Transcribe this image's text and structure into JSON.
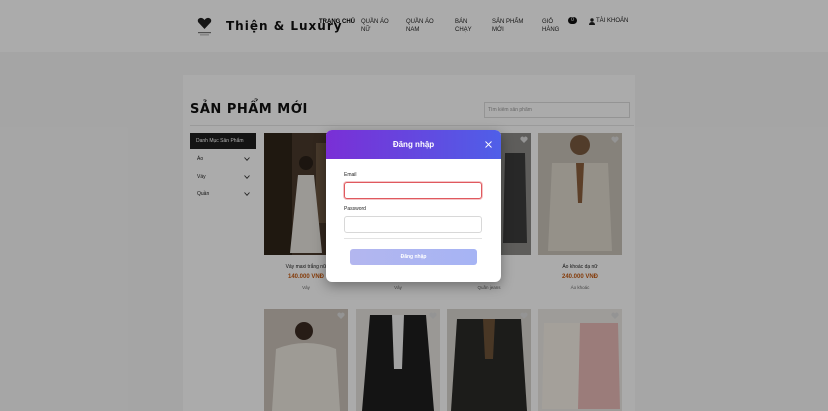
{
  "header": {
    "brand": "Thiện & Luxury",
    "nav": [
      {
        "label": "TRANG CHỦ",
        "active": true
      },
      {
        "label": "QUẦN ÁO NỮ",
        "active": false
      },
      {
        "label": "QUẦN ÁO NAM",
        "active": false
      },
      {
        "label": "BÁN CHẠY",
        "active": false
      },
      {
        "label": "SẢN PHẨM MỚI",
        "active": false
      },
      {
        "label": "GIỎ HÀNG",
        "active": false
      }
    ],
    "cart_count": "0",
    "account_label": "TÀI KHOẢN",
    "icons": [
      "logo-icon",
      "user-icon"
    ]
  },
  "main": {
    "title": "SẢN PHẨM MỚI",
    "search_placeholder": "Tìm kiếm sản phẩm"
  },
  "sidebar": {
    "heading": "Danh Mục Sản Phẩm",
    "items": [
      {
        "label": "Áo"
      },
      {
        "label": "Váy"
      },
      {
        "label": "Quần"
      }
    ]
  },
  "products": [
    {
      "name": "Váy maxi trắng nữ",
      "price": "140.000 VNĐ",
      "category": "Váy"
    },
    {
      "name": "",
      "price": "",
      "category": "Váy"
    },
    {
      "name": "...ối nam",
      "price": "...0 VNĐ",
      "category": "Quần jeans"
    },
    {
      "name": "Áo khoác dạ nữ",
      "price": "240.000 VNĐ",
      "category": "Áo khoác"
    },
    {
      "name": "",
      "price": "",
      "category": ""
    },
    {
      "name": "",
      "price": "",
      "category": ""
    },
    {
      "name": "",
      "price": "",
      "category": ""
    },
    {
      "name": "",
      "price": "",
      "category": ""
    }
  ],
  "login_modal": {
    "title": "Đăng nhập",
    "email_label": "Email",
    "email_value": "",
    "password_label": "Password",
    "password_value": "",
    "submit_label": "Đăng nhập"
  },
  "colors": {
    "modal_gradient_start": "#7a2fd6",
    "modal_gradient_end": "#4f5fe8",
    "price": "#c55a11",
    "focus_border": "#e0595e"
  }
}
